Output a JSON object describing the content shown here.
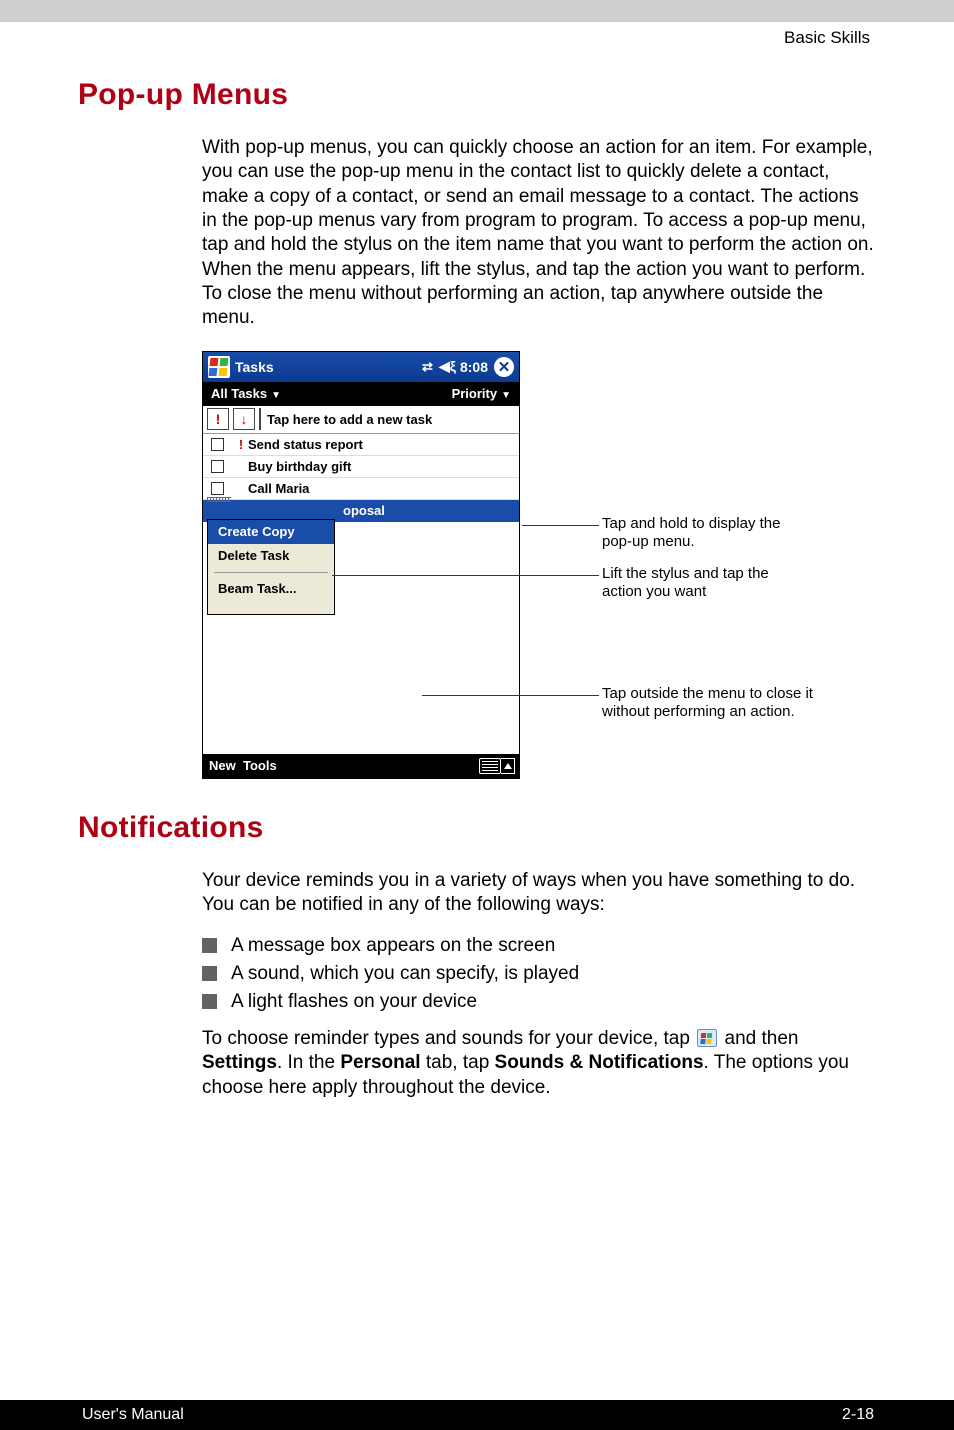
{
  "header": {
    "section": "Basic Skills"
  },
  "headings": {
    "popup": "Pop-up Menus",
    "notifications": "Notifications"
  },
  "paragraphs": {
    "popup": "With pop-up menus, you can quickly choose an action for an item. For example, you can use the pop-up menu in the contact list to quickly delete a contact, make a copy of a contact, or send an email message to a contact. The actions in the pop-up menus vary from program to program. To access a pop-up menu, tap and hold the stylus on the item name that you want to perform the action on. When the menu appears, lift the stylus, and tap the action you want to perform. To close the menu without performing an action, tap anywhere outside the menu.",
    "notif_intro": "Your device reminds you in a variety of ways when you have something to do. You can be notified in any of the following ways:",
    "notif_tail_pre": "To choose reminder types and sounds for your device, tap ",
    "notif_tail_mid1": " and then ",
    "notif_tail_bold1": "Settings",
    "notif_tail_mid2": ". In the  ",
    "notif_tail_bold2": "Personal",
    "notif_tail_mid3": "  tab, tap  ",
    "notif_tail_bold3": "Sounds & Notifications",
    "notif_tail_end": ". The options you choose here apply throughout the device."
  },
  "bullets": [
    "A message box appears on the screen",
    "A sound, which you can specify, is played",
    "A light flashes on your device"
  ],
  "device": {
    "title": "Tasks",
    "time": "8:08",
    "filter_left": "All Tasks",
    "filter_right": "Priority",
    "add_text": "Tap here to add a new task",
    "tasks": [
      {
        "priority": true,
        "label": "Send status report"
      },
      {
        "priority": false,
        "label": "Buy birthday gift"
      },
      {
        "priority": false,
        "label": "Call Maria"
      }
    ],
    "selected_fragment": "oposal",
    "popup_items": {
      "item1": "Create Copy",
      "item2": "Delete Task",
      "item3": "Beam Task..."
    },
    "bottom": {
      "new": "New",
      "tools": "Tools"
    }
  },
  "callouts": {
    "c1": "Tap and hold to display the pop-up menu.",
    "c2": "Lift the stylus and tap the action you want",
    "c3": "Tap outside the menu to close it without performing an action."
  },
  "footer": {
    "left": "User's Manual",
    "right": "2-18"
  }
}
